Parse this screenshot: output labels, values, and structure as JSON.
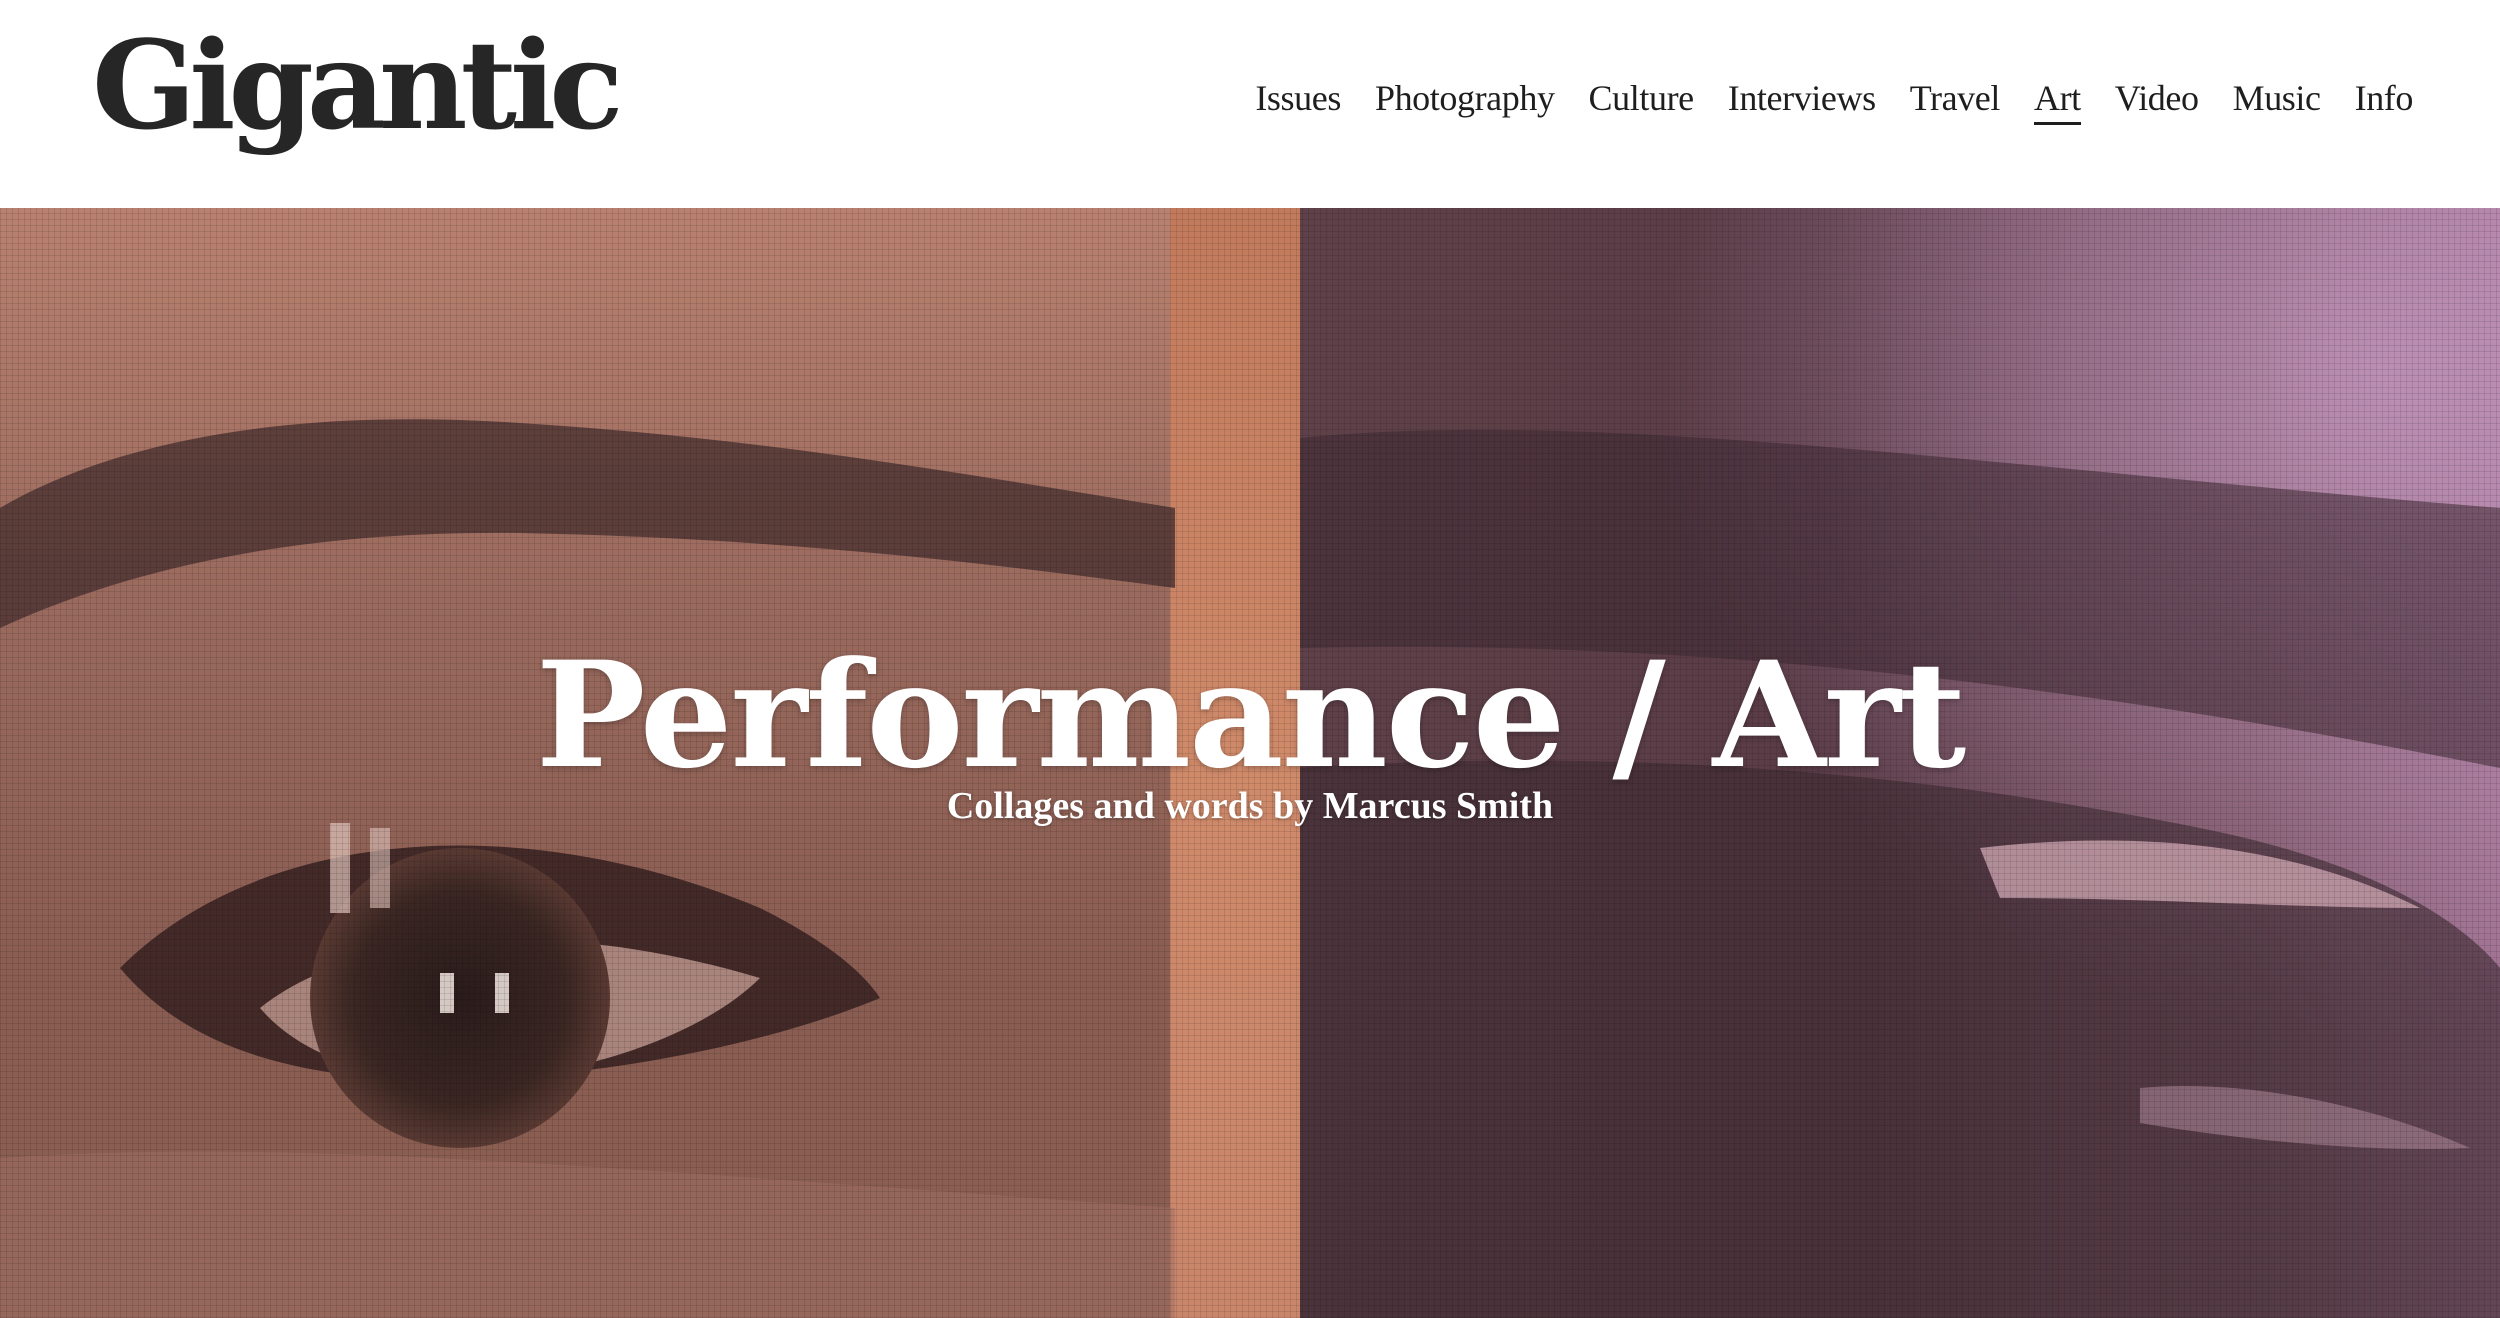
{
  "site": {
    "logo_text": "Gigantic"
  },
  "nav": {
    "items": [
      {
        "label": "Issues"
      },
      {
        "label": "Photography"
      },
      {
        "label": "Culture"
      },
      {
        "label": "Interviews"
      },
      {
        "label": "Travel"
      },
      {
        "label": "Art",
        "active": true
      },
      {
        "label": "Video"
      },
      {
        "label": "Music"
      },
      {
        "label": "Info"
      }
    ]
  },
  "hero": {
    "title": "Performance / Art",
    "subtitle": "Collages and words by Marcus Smith",
    "image_icon": "collage-eyes-image"
  },
  "colors": {
    "text_dark": "#1e1e1e",
    "hero_text": "#ffffff",
    "header_bg": "#ffffff"
  }
}
